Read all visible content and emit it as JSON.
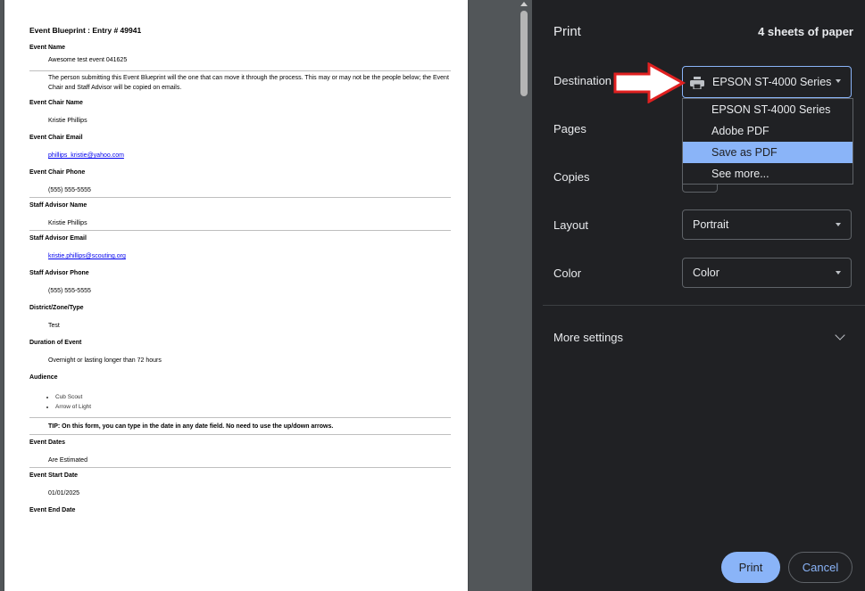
{
  "document": {
    "title": "Event Blueprint : Entry # 49941",
    "sections": [
      {
        "label": "Event Name",
        "value": "Awesome test event 041625",
        "desc": "The person submitting this Event Blueprint will the one that can move it through the process. This may or may not be the people below; the Event Chair and Staff Advisor will be copied on emails."
      },
      {
        "label": "Event Chair Name",
        "value": "Kristie Phillips"
      },
      {
        "label": "Event Chair Email",
        "value": "phillips_kristie@yahoo.com",
        "link": true
      },
      {
        "label": "Event Chair Phone",
        "value": "(555) 555-5555"
      },
      {
        "label": "Staff Advisor Name",
        "value": "Kristie Phillips"
      },
      {
        "label": "Staff Advisor Email",
        "value": "kristie.phillips@scouting.org",
        "link": true
      },
      {
        "label": "Staff Advisor Phone",
        "value": "(555) 555-5555"
      },
      {
        "label": "District/Zone/Type",
        "value": "Test"
      },
      {
        "label": "Duration of Event",
        "value": "Overnight or lasting longer than 72 hours"
      }
    ],
    "audience_label": "Audience",
    "audience": [
      "Cub Scout",
      "Arrow of Light"
    ],
    "tip": "TIP: On this form, you can type in the date in any date field. No need to use the up/down arrows.",
    "sections2": [
      {
        "label": "Event Dates",
        "value": "Are Estimated"
      },
      {
        "label": "Event Start Date",
        "value": "01/01/2025"
      }
    ],
    "last_label": "Event End Date"
  },
  "panel": {
    "title": "Print",
    "sheets": "4 sheets of paper",
    "destination_label": "Destination",
    "destination_value": "EPSON ST-4000 Series",
    "destination_options": [
      "EPSON ST-4000 Series",
      "Adobe PDF",
      "Save as PDF",
      "See more..."
    ],
    "highlighted_option_index": 2,
    "pages_label": "Pages",
    "copies_label": "Copies",
    "layout_label": "Layout",
    "layout_value": "Portrait",
    "color_label": "Color",
    "color_value": "Color",
    "more_settings": "More settings",
    "print_button": "Print",
    "cancel_button": "Cancel"
  },
  "colors": {
    "panel_bg": "#202124",
    "accent": "#8ab4f8",
    "preview_bg": "#525659",
    "annotation_arrow": "#e02020"
  },
  "icons": [
    "printer-icon",
    "chevron-down-icon",
    "red-arrow-annotation"
  ]
}
